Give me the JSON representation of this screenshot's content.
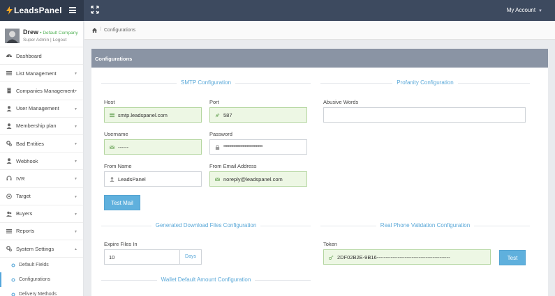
{
  "brand": {
    "name": "LeadsPanel"
  },
  "header": {
    "account_label": "My Account"
  },
  "profile": {
    "name": "Drew",
    "company": "Default Company",
    "role": "Super Admin",
    "separator": "|",
    "logout": "Logout"
  },
  "sidebar": {
    "items": [
      {
        "label": "Dashboard",
        "icon": "dashboard-icon",
        "has_caret": false
      },
      {
        "label": "List Management",
        "icon": "list-icon",
        "has_caret": true
      },
      {
        "label": "Companies Management",
        "icon": "building-icon",
        "has_caret": true
      },
      {
        "label": "User Management",
        "icon": "user-icon",
        "has_caret": true
      },
      {
        "label": "Membership plan",
        "icon": "user-icon",
        "has_caret": true
      },
      {
        "label": "Bad Entities",
        "icon": "cogs-icon",
        "has_caret": true
      },
      {
        "label": "Webhook",
        "icon": "user-icon",
        "has_caret": true
      },
      {
        "label": "IVR",
        "icon": "headset-icon",
        "has_caret": true
      },
      {
        "label": "Target",
        "icon": "target-icon",
        "has_caret": true
      },
      {
        "label": "Buyers",
        "icon": "users-icon",
        "has_caret": true
      },
      {
        "label": "Reports",
        "icon": "list-icon",
        "has_caret": true
      },
      {
        "label": "System Settings",
        "icon": "cogs-icon",
        "has_caret": true
      }
    ],
    "sub_items": [
      {
        "label": "Default Fields",
        "icon": "gear-icon"
      },
      {
        "label": "Configurations",
        "icon": "gear-icon"
      },
      {
        "label": "Delivery Methods",
        "icon": "gear-icon"
      }
    ]
  },
  "breadcrumb": {
    "current": "Configurations"
  },
  "panel": {
    "title": "Configurations"
  },
  "smtp": {
    "title": "SMTP Configuration",
    "host_label": "Host",
    "host_value": "smtp.leadspanel.com",
    "port_label": "Port",
    "port_value": "587",
    "username_label": "Username",
    "username_value": "------",
    "password_label": "Password",
    "password_value": "•••••••••••••••••••••••••••••••••••",
    "from_name_label": "From Name",
    "from_name_value": "LeadsPanel",
    "from_email_label": "From Email Address",
    "from_email_value": "noreply@leadspanel.com",
    "test_button": "Test Mail"
  },
  "profanity": {
    "title": "Profanity Configuration",
    "abusive_label": "Abusive Words",
    "abusive_value": ""
  },
  "downloads": {
    "title": "Generated Download Files Configuration",
    "expire_label": "Expire Files In",
    "expire_value": "10",
    "expire_unit": "Days"
  },
  "phone_validation": {
    "title": "Real Phone Validation Configuration",
    "token_label": "Token",
    "token_value": "2DF02B2E-9B16------------------------------------------",
    "test_button": "Test"
  },
  "wallet": {
    "title": "Wallet Default Amount Configuration"
  },
  "colors": {
    "topbar": "#3d4a5f",
    "brand_bg": "#2f3a4c",
    "accent": "#5fb0dd",
    "success_bg": "#edf7e4",
    "panel_head": "#8a94a4"
  }
}
